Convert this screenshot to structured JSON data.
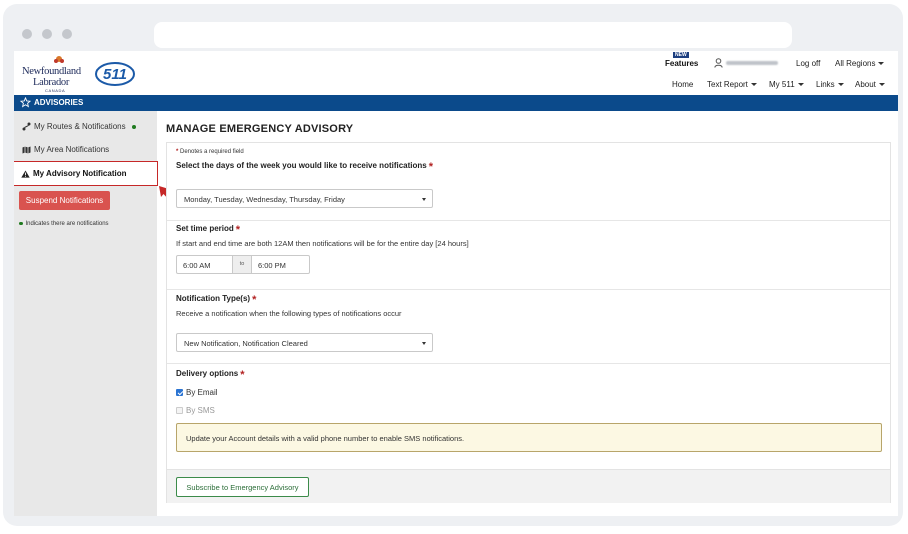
{
  "header": {
    "logo_line1": "Newfoundland",
    "logo_line2": "Labrador",
    "logo_line3": "CANADA",
    "logo_511": "511",
    "new_badge": "NEW",
    "features": "Features",
    "log_off": "Log off",
    "regions": "All Regions",
    "nav": {
      "home": "Home",
      "text_report": "Text Report",
      "my511": "My 511",
      "links": "Links",
      "about": "About"
    }
  },
  "bluebar": {
    "label": "ADVISORIES"
  },
  "sidebar": {
    "routes": "My Routes & Notifications",
    "area": "My Area Notifications",
    "advisory": "My Advisory Notification",
    "suspend": "Suspend Notifications",
    "indicates": "Indicates there are notifications"
  },
  "main": {
    "title": "MANAGE EMERGENCY ADVISORY",
    "required_mark": "*",
    "required_note": "Denotes a required field",
    "days_label": "Select the days of the week you would like to receive notifications",
    "days_value": "Monday, Tuesday, Wednesday, Thursday, Friday",
    "time_label": "Set time period",
    "time_desc": "If start and end time are both 12AM then notifications will be for the entire day [24 hours]",
    "time_start": "6:00 AM",
    "time_to": "to",
    "time_end": "6:00 PM",
    "type_label": "Notification Type(s)",
    "type_desc": "Receive a notification when the following types of notifications occur",
    "type_value": "New Notification, Notification Cleared",
    "delivery_label": "Delivery options",
    "by_email": "By Email",
    "by_sms": "By SMS",
    "alert": "Update your Account details with a valid phone number to enable SMS notifications.",
    "subscribe": "Subscribe to Emergency Advisory"
  },
  "colors": {
    "brand_blue": "#0b4a8b",
    "danger": "#d9534f",
    "success": "#3c8b4a",
    "highlight": "#c62828"
  }
}
